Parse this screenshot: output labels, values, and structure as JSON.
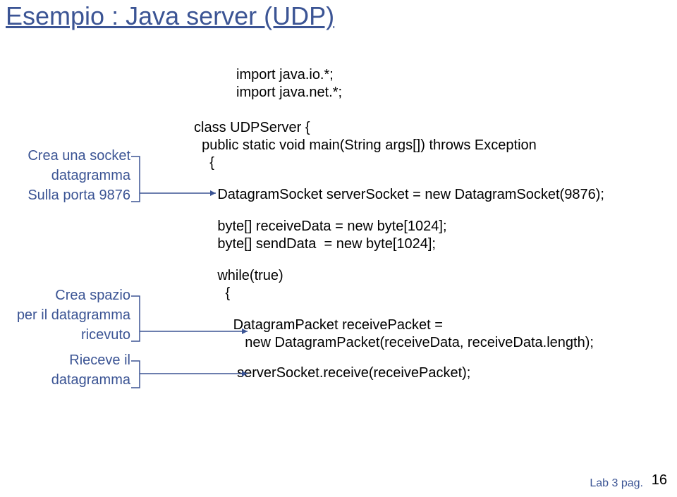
{
  "title": "Esempio : Java server (UDP)",
  "code": {
    "l1": "import java.io.*;",
    "l2": "import java.net.*;",
    "l3": "class UDPServer {",
    "l4": "  public static void main(String args[]) throws Exception",
    "l5": "    {",
    "l6": "      DatagramSocket serverSocket = new DatagramSocket(9876);",
    "l7": "      byte[] receiveData = new byte[1024];",
    "l8": "      byte[] sendData  = new byte[1024];",
    "l9": "      while(true)",
    "l10": "        {",
    "l11": "          DatagramPacket receivePacket =",
    "l12": "             new DatagramPacket(receiveData, receiveData.length);",
    "l13": "           serverSocket.receive(receivePacket);"
  },
  "annotations": {
    "a1_l1": "Crea una socket",
    "a1_l2": "datagramma",
    "a1_l3": "Sulla porta 9876",
    "a2_l1": "Crea spazio",
    "a2_l2": "per il datagramma",
    "a2_l3": "ricevuto",
    "a3_l1": "Rieceve il",
    "a3_l2": "datagramma"
  },
  "footer": {
    "page": "16",
    "lab": "Lab 3 pag."
  }
}
